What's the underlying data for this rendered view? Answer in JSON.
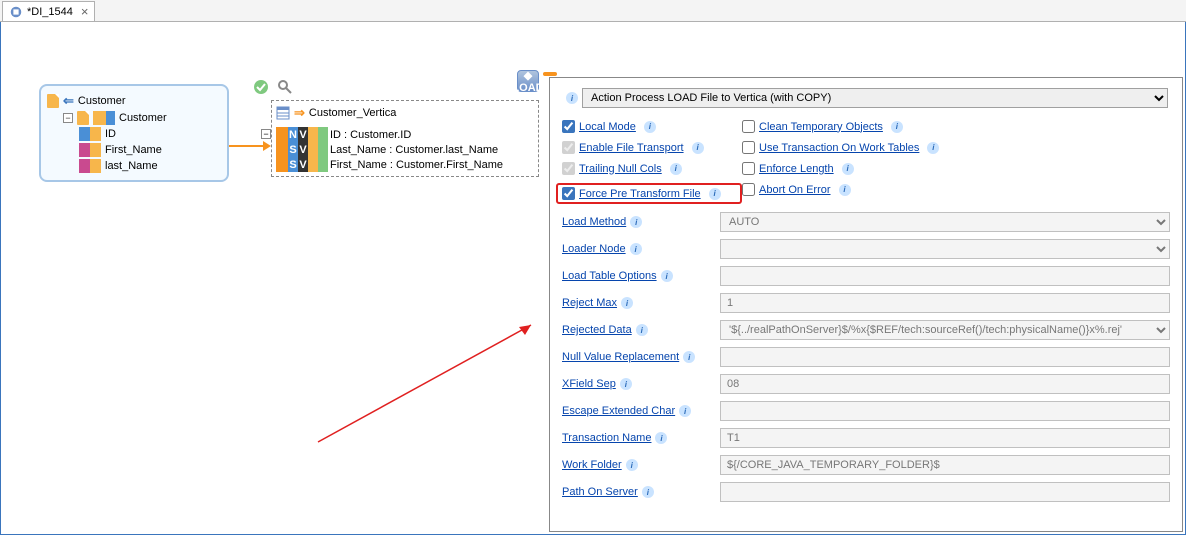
{
  "tab": {
    "title": "*DI_1544"
  },
  "source": {
    "title": "Customer",
    "nested_title": "Customer",
    "fields": [
      "ID",
      "First_Name",
      "last_Name"
    ]
  },
  "vertica": {
    "title": "Customer_Vertica",
    "rows": [
      "ID : Customer.ID",
      "Last_Name : Customer.last_Name",
      "First_Name : Customer.First_Name"
    ]
  },
  "props": {
    "action": "Action Process LOAD File to Vertica (with COPY)",
    "checks_left": [
      {
        "label": "Local Mode",
        "checked": true,
        "disabled": false,
        "highlight": false
      },
      {
        "label": "Enable File Transport",
        "checked": true,
        "disabled": true,
        "highlight": false
      },
      {
        "label": "Trailing Null Cols",
        "checked": true,
        "disabled": true,
        "highlight": false
      },
      {
        "label": "Force Pre Transform File",
        "checked": true,
        "disabled": false,
        "highlight": true
      }
    ],
    "checks_right": [
      {
        "label": "Clean Temporary Objects",
        "checked": false,
        "disabled": false
      },
      {
        "label": "Use Transaction On Work Tables",
        "checked": false,
        "disabled": false
      },
      {
        "label": "Enforce Length",
        "checked": false,
        "disabled": false
      },
      {
        "label": "Abort On Error",
        "checked": false,
        "disabled": false
      }
    ],
    "fields": [
      {
        "label": "Load Method",
        "value": "AUTO",
        "type": "select"
      },
      {
        "label": "Loader Node",
        "value": "",
        "type": "select"
      },
      {
        "label": "Load Table Options",
        "value": "",
        "type": "text"
      },
      {
        "label": "Reject Max",
        "value": "1",
        "type": "text"
      },
      {
        "label": "Rejected Data",
        "value": "'${../realPathOnServer}$/%x{$REF/tech:sourceRef()/tech:physicalName()}x%.rej'",
        "type": "select"
      },
      {
        "label": "Null Value Replacement",
        "value": "",
        "type": "text"
      },
      {
        "label": "XField Sep",
        "value": "08",
        "type": "text"
      },
      {
        "label": "Escape Extended Char",
        "value": "",
        "type": "text"
      },
      {
        "label": "Transaction Name",
        "value": "T1",
        "type": "text"
      },
      {
        "label": "Work Folder",
        "value": "${/CORE_JAVA_TEMPORARY_FOLDER}$",
        "type": "text"
      },
      {
        "label": "Path On Server",
        "value": "",
        "type": "text"
      }
    ]
  }
}
